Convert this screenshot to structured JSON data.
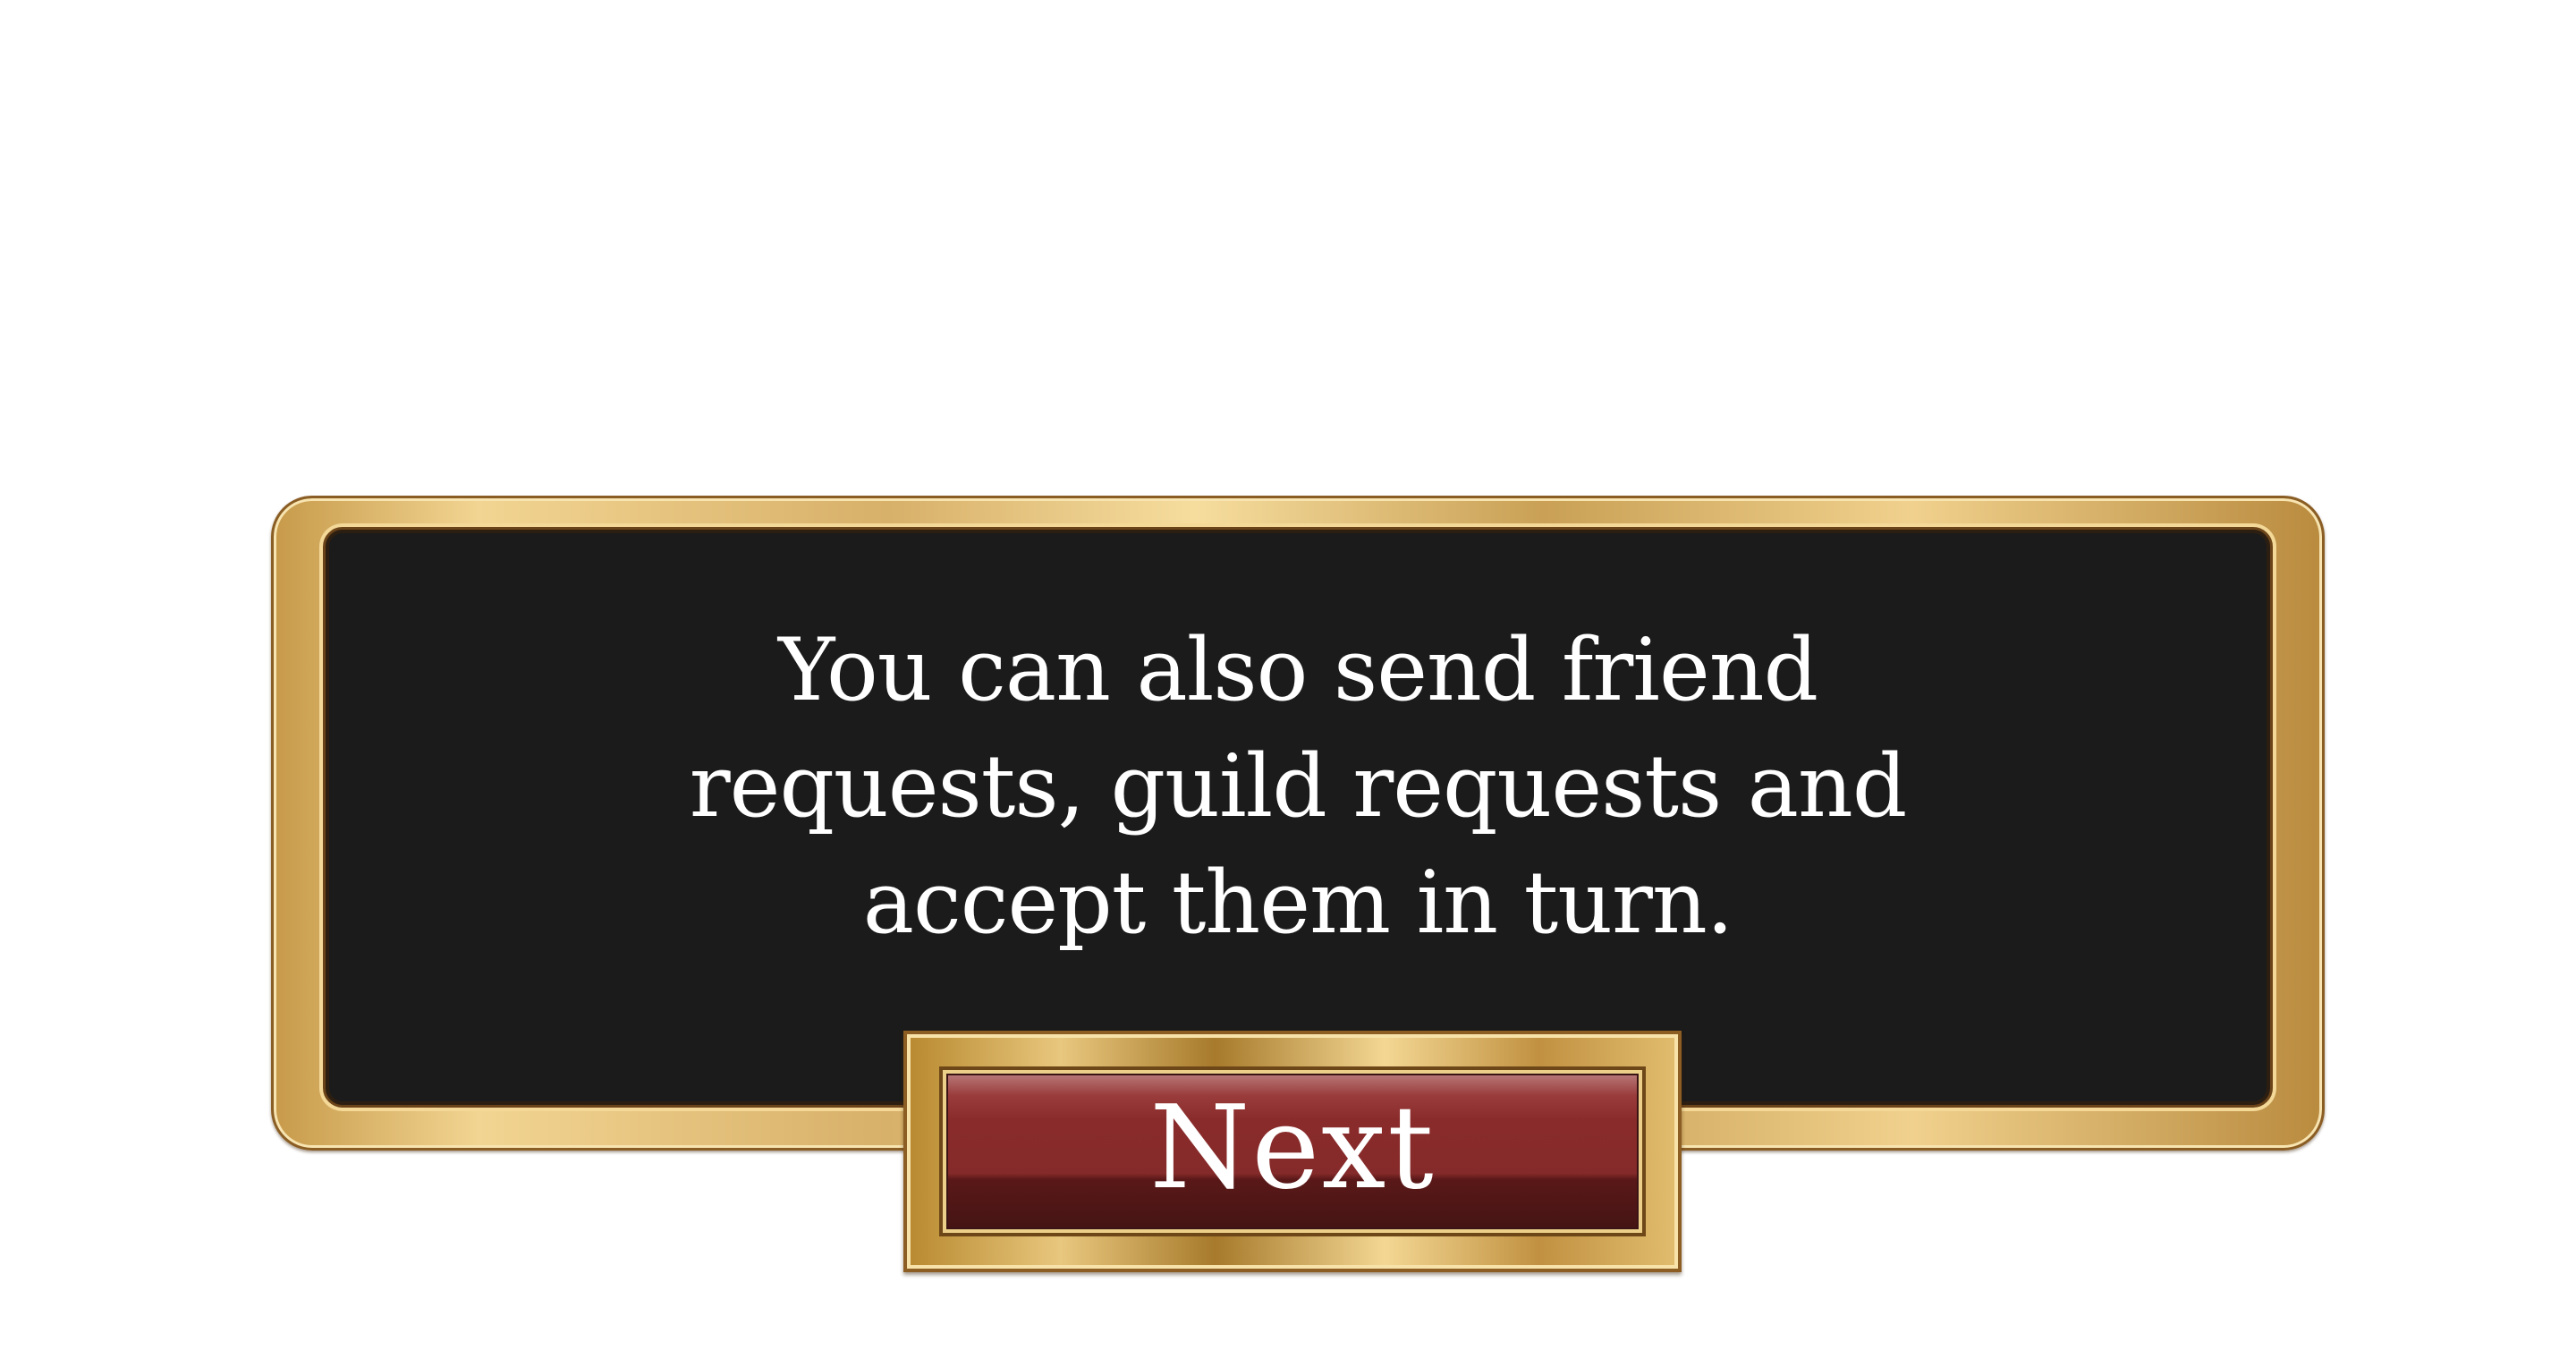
{
  "dialog": {
    "lines": [
      "You can also send friend",
      "requests, guild requests and",
      "accept them in turn."
    ],
    "button_label": "Next"
  },
  "colors": {
    "panel_background": "#1b1b1b",
    "frame_gold": "#e2bd6f",
    "button_red": "#8a2b2b",
    "text": "#ffffff"
  }
}
